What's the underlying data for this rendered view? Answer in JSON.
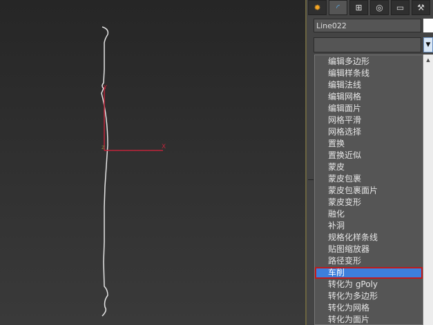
{
  "object_name": "Line022",
  "tabs": [
    "create-icon",
    "modify-icon",
    "hierarchy-icon",
    "motion-icon",
    "display-icon",
    "utilities-icon"
  ],
  "gizmo": {
    "x_label": "X",
    "y_label": "Y",
    "z_label": "Z"
  },
  "modifier_list": [
    "编辑多边形",
    "编辑样条线",
    "编辑法线",
    "编辑网格",
    "编辑面片",
    "网格平滑",
    "网格选择",
    "置换",
    "置换近似",
    "蒙皮",
    "蒙皮包裹",
    "蒙皮包裹面片",
    "蒙皮变形",
    "融化",
    "补洞",
    "规格化样条线",
    "贴图缩放器",
    "路径变形",
    "车削",
    "转化为 gPoly",
    "转化为多边形",
    "转化为网格",
    "转化为面片"
  ],
  "selected_index": 18,
  "colors": {
    "highlight": "#3d7fdc",
    "highlight_border": "#c01a1a"
  }
}
